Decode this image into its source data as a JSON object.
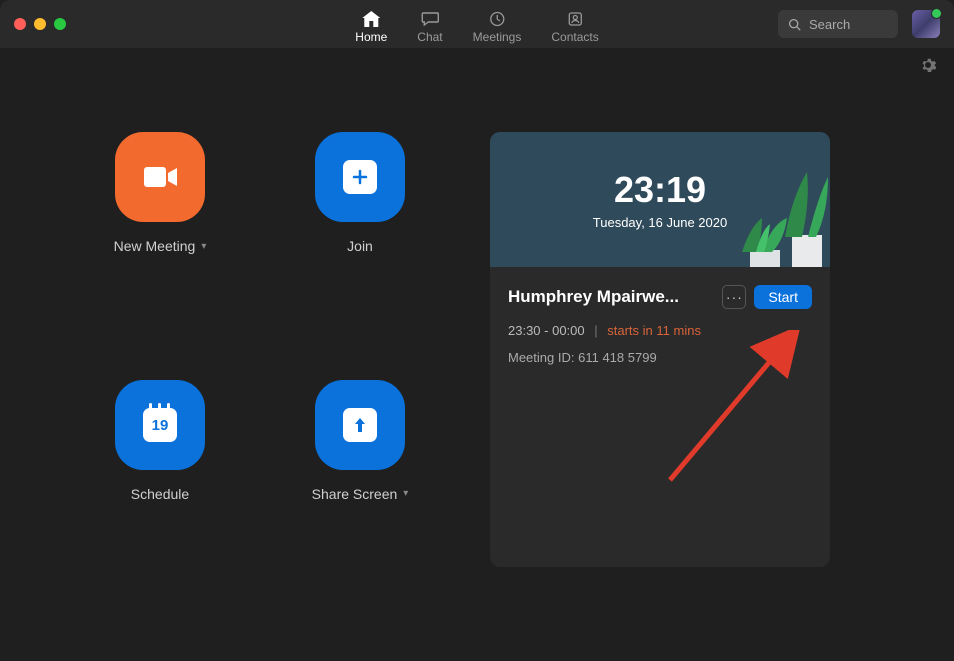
{
  "window": {
    "traffic_lights": [
      "close",
      "minimize",
      "maximize"
    ]
  },
  "nav": {
    "tabs": [
      {
        "id": "home",
        "label": "Home",
        "icon": "home-icon",
        "active": true
      },
      {
        "id": "chat",
        "label": "Chat",
        "icon": "chat-icon",
        "active": false
      },
      {
        "id": "meetings",
        "label": "Meetings",
        "icon": "clock-icon",
        "active": false
      },
      {
        "id": "contacts",
        "label": "Contacts",
        "icon": "contacts-icon",
        "active": false
      }
    ],
    "search_placeholder": "Search"
  },
  "tiles": {
    "new_meeting": {
      "label": "New Meeting",
      "has_dropdown": true,
      "color": "#f26a2d",
      "icon": "video-icon"
    },
    "join": {
      "label": "Join",
      "has_dropdown": false,
      "color": "#0b72dc",
      "icon": "plus-icon"
    },
    "schedule": {
      "label": "Schedule",
      "has_dropdown": false,
      "color": "#0b72dc",
      "icon": "calendar-icon",
      "calendar_day": "19"
    },
    "share_screen": {
      "label": "Share Screen",
      "has_dropdown": true,
      "color": "#0b72dc",
      "icon": "arrow-up-icon"
    }
  },
  "panel": {
    "clock": {
      "time": "23:19",
      "date": "Tuesday, 16 June 2020"
    },
    "meeting": {
      "title": "Humphrey Mpairwe...",
      "more_label": "···",
      "start_label": "Start",
      "time_range": "23:30 - 00:00",
      "separator": "|",
      "starts_in": "starts in 11 mins",
      "meeting_id_label": "Meeting ID:",
      "meeting_id": "611 418 5799"
    }
  },
  "colors": {
    "accent_orange": "#f26a2d",
    "accent_blue": "#0b72dc",
    "warn": "#d9643a"
  }
}
